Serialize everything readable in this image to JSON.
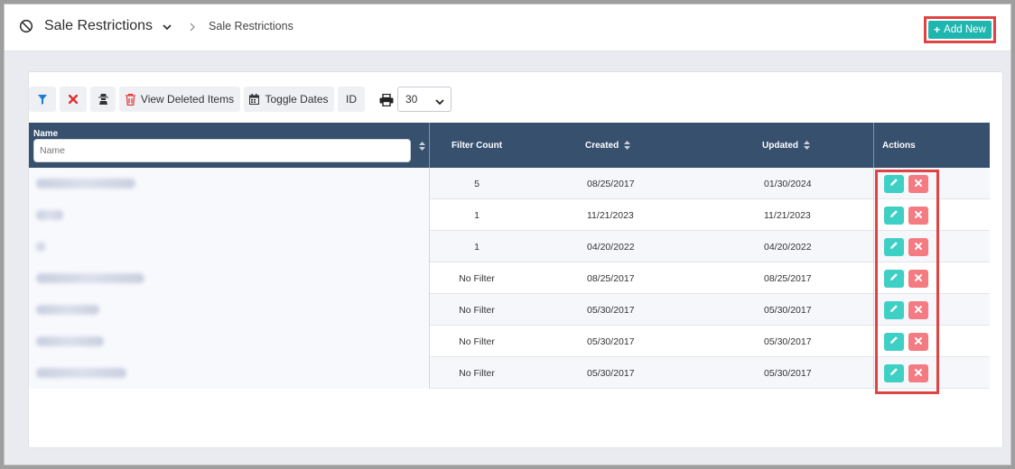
{
  "header": {
    "title": "Sale Restrictions",
    "breadcrumb": "Sale Restrictions",
    "add_button": "Add New"
  },
  "toolbar": {
    "view_deleted": "View Deleted Items",
    "toggle_dates": "Toggle Dates",
    "id_label": "ID",
    "page_size": "30"
  },
  "table": {
    "columns": {
      "name": "Name",
      "filter_count": "Filter Count",
      "created": "Created",
      "updated": "Updated",
      "actions": "Actions"
    },
    "name_filter_placeholder": "Name",
    "rows": [
      {
        "filter_count": "5",
        "created": "08/25/2017",
        "updated": "01/30/2024"
      },
      {
        "filter_count": "1",
        "created": "11/21/2023",
        "updated": "11/21/2023"
      },
      {
        "filter_count": "1",
        "created": "04/20/2022",
        "updated": "04/20/2022"
      },
      {
        "filter_count": "No Filter",
        "created": "08/25/2017",
        "updated": "08/25/2017"
      },
      {
        "filter_count": "No Filter",
        "created": "05/30/2017",
        "updated": "05/30/2017"
      },
      {
        "filter_count": "No Filter",
        "created": "05/30/2017",
        "updated": "05/30/2017"
      },
      {
        "filter_count": "No Filter",
        "created": "05/30/2017",
        "updated": "05/30/2017"
      }
    ]
  },
  "colors": {
    "accent": "#1fb6b0",
    "header_bg": "#36506e",
    "edit": "#3ecfc5",
    "delete": "#f47b82",
    "highlight": "#e04343"
  }
}
